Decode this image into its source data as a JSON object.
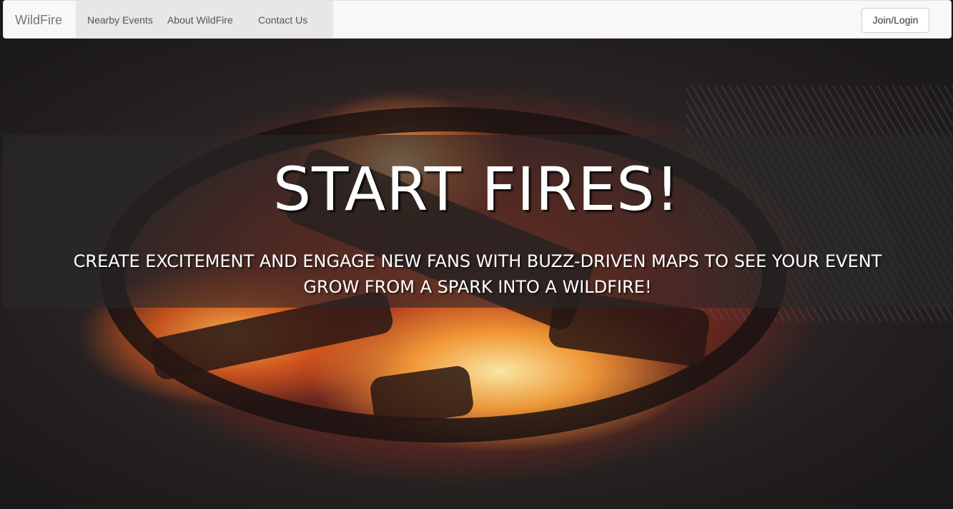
{
  "navbar": {
    "brand": "WildFire",
    "links": [
      {
        "label": "Nearby Events"
      },
      {
        "label": "About WildFire"
      },
      {
        "label": "Contact Us"
      }
    ],
    "login_label": "Join/Login"
  },
  "hero": {
    "title": "START FIRES!",
    "subtitle": "CREATE EXCITEMENT AND ENGAGE NEW FANS WITH BUZZ-DRIVEN MAPS TO SEE YOUR EVENT GROW FROM A SPARK INTO A WILDFIRE!",
    "background_image": "campfire in metal fire pit"
  },
  "colors": {
    "navbar_bg": "#f8f8f8",
    "active_nav_bg": "#e7e7e7",
    "hero_band": "rgba(40,40,40,0.62)",
    "hero_text": "#ffffff"
  }
}
